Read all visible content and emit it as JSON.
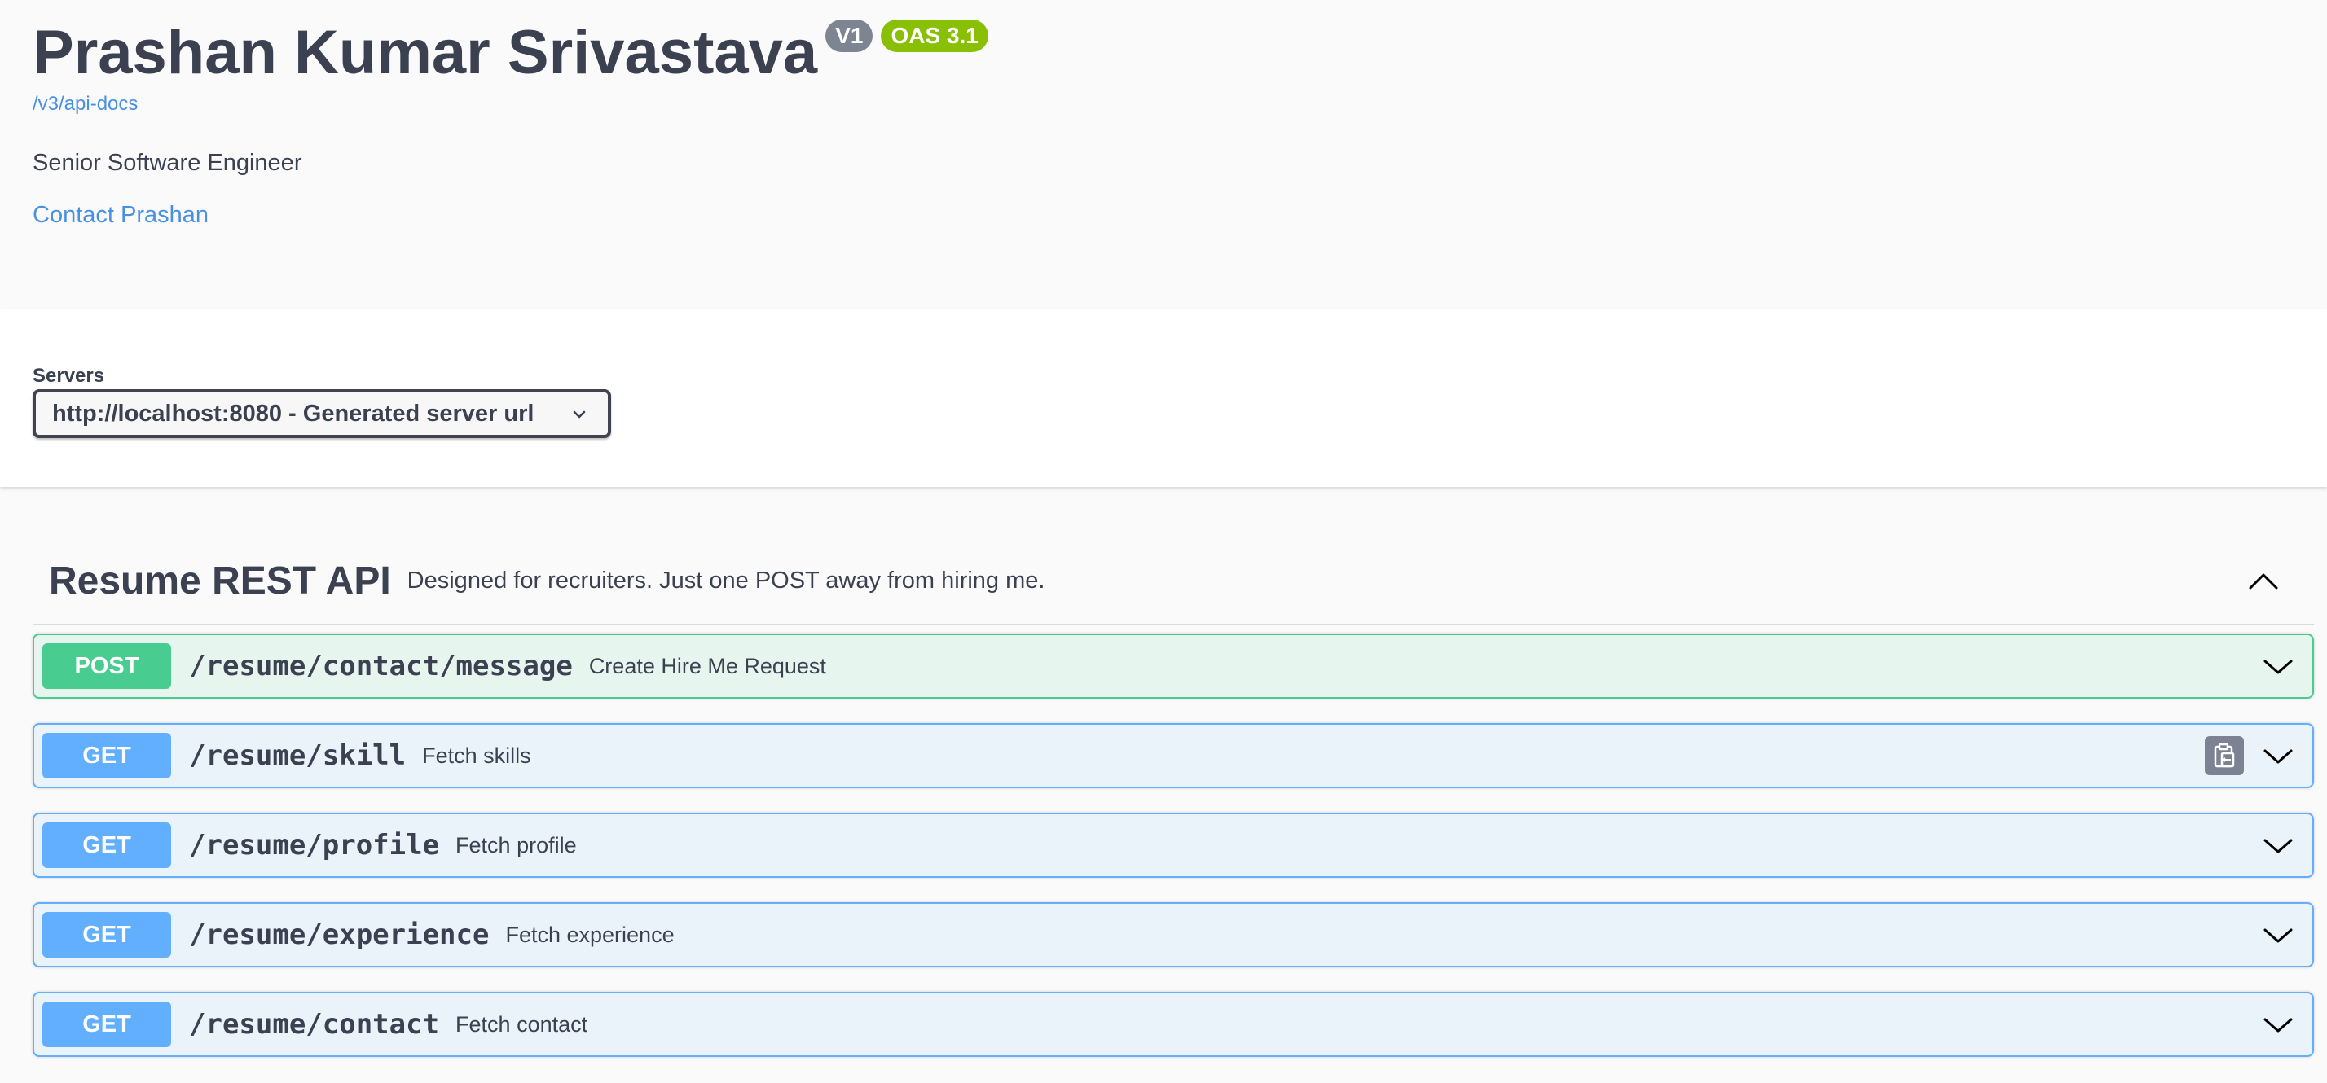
{
  "info": {
    "title": "Prashan Kumar Srivastava",
    "version_badge": "V1",
    "oas_badge": "OAS 3.1",
    "spec_url": "/v3/api-docs",
    "description": "Senior Software Engineer",
    "contact_link": "Contact Prashan"
  },
  "servers": {
    "label": "Servers",
    "selected": "http://localhost:8080 - Generated server url"
  },
  "tag": {
    "name": "Resume REST API",
    "description": "Designed for recruiters. Just one POST away from hiring me.",
    "expanded": true
  },
  "operations": [
    {
      "method": "POST",
      "path": "/resume/contact/message",
      "summary": "Create Hire Me Request",
      "color": "#49cc90"
    },
    {
      "method": "GET",
      "path": "/resume/skill",
      "summary": "Fetch skills",
      "color": "#61affe",
      "copy_icon": "clipboard-icon"
    },
    {
      "method": "GET",
      "path": "/resume/profile",
      "summary": "Fetch profile",
      "color": "#61affe"
    },
    {
      "method": "GET",
      "path": "/resume/experience",
      "summary": "Fetch experience",
      "color": "#61affe"
    },
    {
      "method": "GET",
      "path": "/resume/contact",
      "summary": "Fetch contact",
      "color": "#61affe"
    }
  ],
  "colors": {
    "link": "#4990e2",
    "badge_version": "#7d8492",
    "badge_oas": "#89bf04"
  }
}
